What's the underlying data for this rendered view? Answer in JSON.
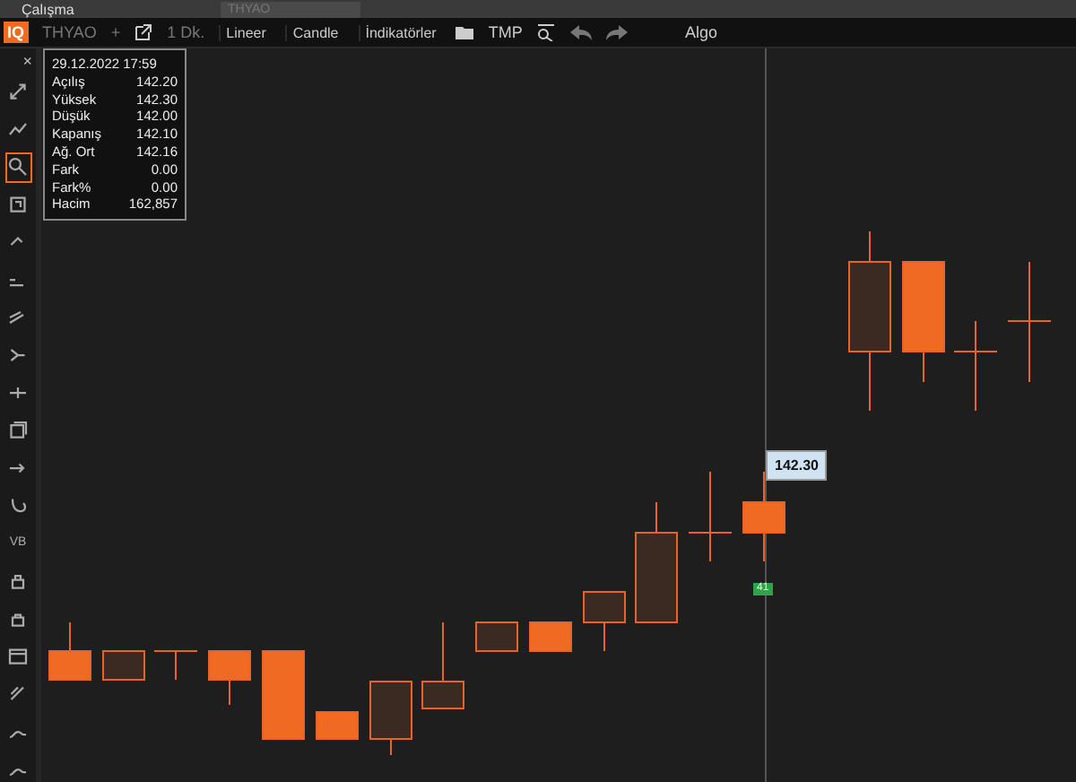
{
  "top_bar": {
    "workspace": "Çalışma",
    "symbol_field": "THYAO"
  },
  "toolbar": {
    "logo": "IQ",
    "symbol": "THYAO",
    "add": "+",
    "interval": "1 Dk.",
    "buttons": [
      "Lineer",
      "Candle",
      "İndikatörler"
    ],
    "template": "TMP",
    "algo": "Algo"
  },
  "tool_panel": {
    "close": "×",
    "tools": [
      {
        "kind": "icon",
        "selected": false
      },
      {
        "kind": "icon",
        "selected": false
      },
      {
        "kind": "icon",
        "selected": true
      },
      {
        "kind": "icon",
        "selected": false
      },
      {
        "kind": "icon",
        "selected": false
      },
      {
        "kind": "icon",
        "selected": false
      },
      {
        "kind": "icon",
        "selected": false
      },
      {
        "kind": "icon",
        "selected": false
      },
      {
        "kind": "icon",
        "selected": false
      },
      {
        "kind": "icon",
        "selected": false
      },
      {
        "kind": "icon",
        "selected": false
      },
      {
        "kind": "icon",
        "selected": false
      },
      {
        "kind": "text",
        "label": "VB",
        "selected": false
      },
      {
        "kind": "icon",
        "selected": false
      },
      {
        "kind": "icon",
        "selected": false
      },
      {
        "kind": "icon",
        "selected": false
      },
      {
        "kind": "icon",
        "selected": false
      },
      {
        "kind": "icon",
        "selected": false
      },
      {
        "kind": "icon",
        "selected": false
      }
    ]
  },
  "info_panel": {
    "datetime": "29.12.2022 17:59",
    "rows": [
      {
        "label": "Açılış",
        "value": "142.20"
      },
      {
        "label": "Yüksek",
        "value": "142.30"
      },
      {
        "label": "Düşük",
        "value": "142.00"
      },
      {
        "label": "Kapanış",
        "value": "142.10"
      },
      {
        "label": "Ağ. Ort",
        "value": "142.16"
      },
      {
        "label": "Fark",
        "value": "0.00"
      },
      {
        "label": "Fark%",
        "value": "0.00"
      },
      {
        "label": "Hacim",
        "value": "162,857"
      }
    ]
  },
  "chart": {
    "price_label": "142.30",
    "volume_marker": "41"
  }
}
